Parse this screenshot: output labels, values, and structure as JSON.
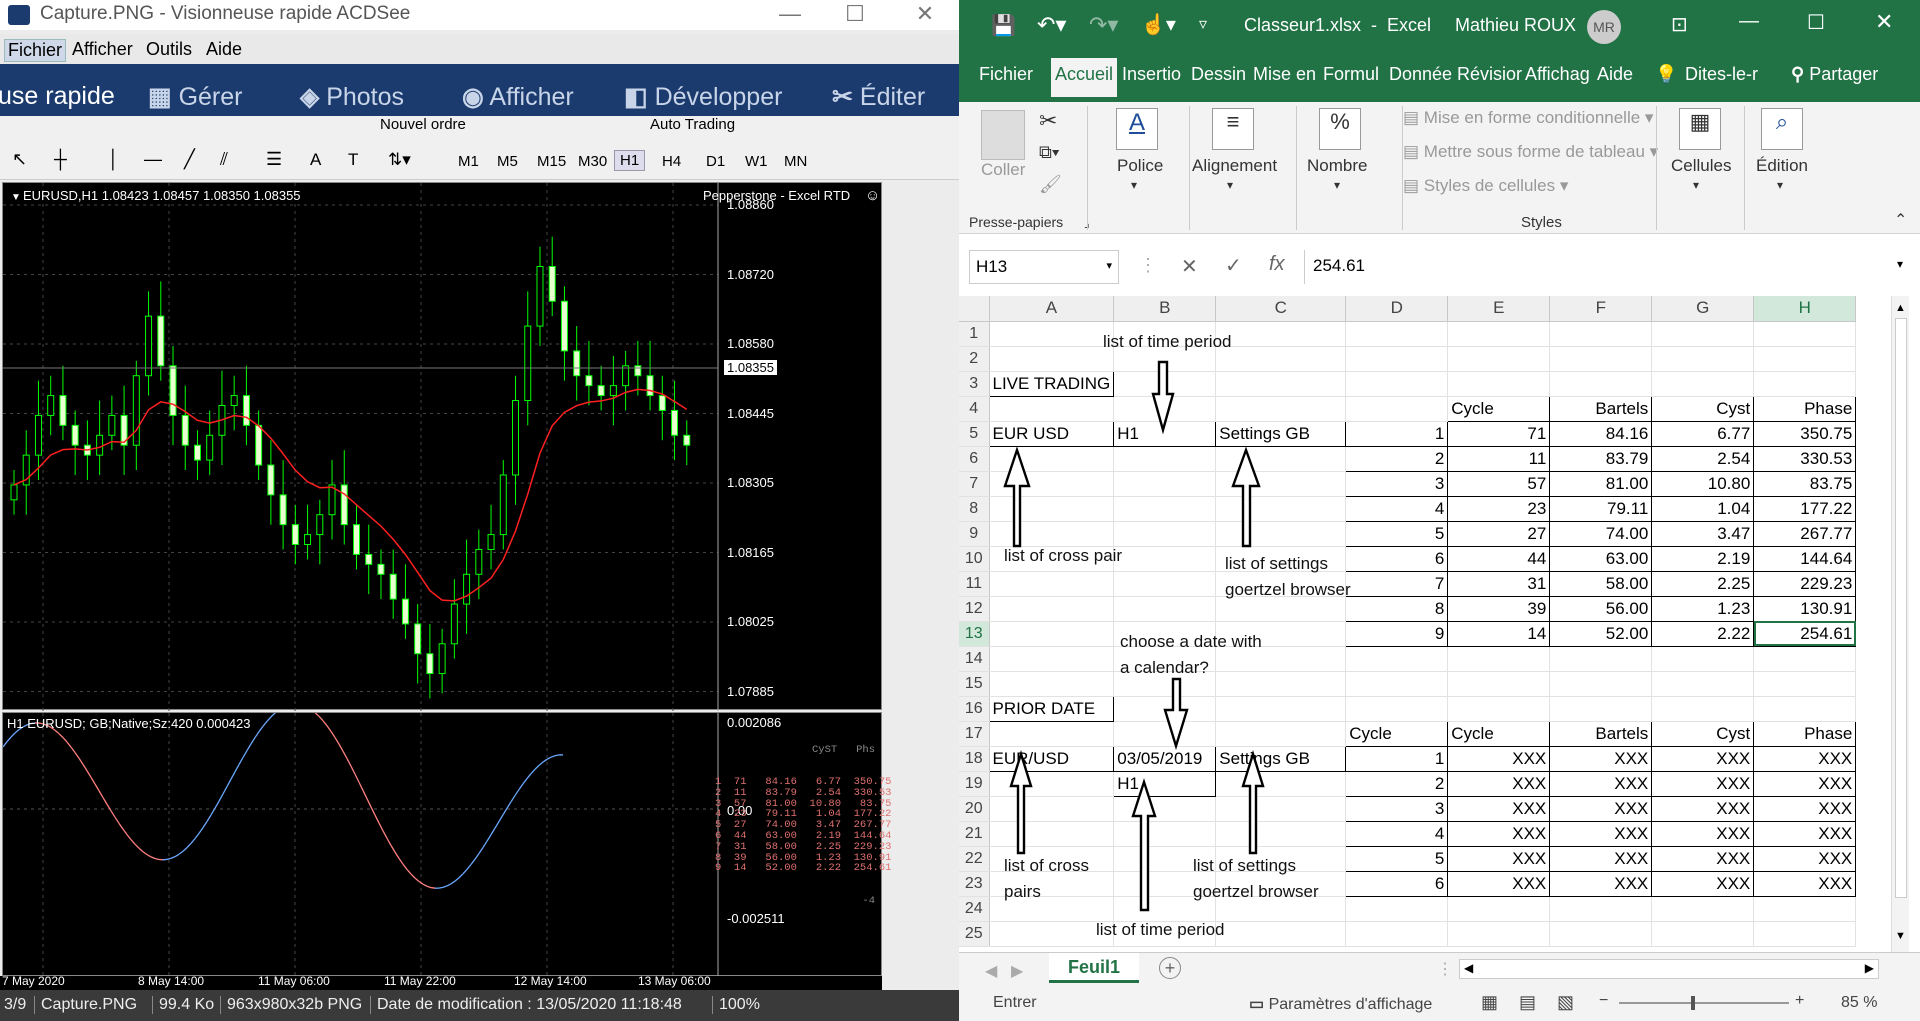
{
  "viewer": {
    "title": "Capture.PNG - Visionneuse rapide ACDSee",
    "menu": [
      "Fichier",
      "Afficher",
      "Outils",
      "Aide"
    ],
    "modes": [
      "use rapide",
      "Gérer",
      "Photos",
      "Afficher",
      "Développer",
      "Éditer"
    ],
    "toolbar_partial": [
      "Nouvel ordre",
      "Auto Trading"
    ],
    "timeframes": [
      "M1",
      "M5",
      "M15",
      "M30",
      "H1",
      "H4",
      "D1",
      "W1",
      "MN"
    ],
    "active_timeframe": "H1",
    "status": {
      "index": "3/9",
      "file": "Capture.PNG",
      "size": "99.4 Ko",
      "dims": "963x980x32b PNG",
      "modified": "Date de modification : 13/05/2020 11:18:48",
      "zoom": "100%"
    }
  },
  "chart": {
    "header": "EURUSD,H1  1.08423 1.08457 1.08350 1.08355",
    "provider": "Pepperstone - Excel RTD",
    "price_ticks": [
      "1.08860",
      "1.08720",
      "1.08580",
      "1.08445",
      "1.08305",
      "1.08165",
      "1.08025",
      "1.07885"
    ],
    "current_price": "1.08355",
    "indicator_header": "H1 EURUSD; GB;Native;Sz:420 0.000423",
    "indicator_ticks": [
      "0.002086",
      "0.00",
      "-0.002511"
    ],
    "indicator_table_header": [
      "CyST",
      "Phs"
    ],
    "indicator_table_rows": [
      "1  71   84.16   6.77  350.75",
      "2  11   83.79   2.54  330.53",
      "3  57   81.00  10.80   83.75",
      "4  23   79.11   1.04  177.22",
      "5  27   74.00   3.47  267.77",
      "6  44   63.00   2.19  144.64",
      "7  31   58.00   2.25  229.23",
      "8  39   56.00   1.23  130.91",
      "9  14   52.00   2.22  254.61"
    ],
    "indicator_marker": "-4",
    "time_ticks": [
      "7 May 2020",
      "8 May 14:00",
      "11 May 06:00",
      "11 May 22:00",
      "12 May 14:00",
      "13 May 06:00"
    ],
    "colors": {
      "bull": "#00ff00",
      "ma": "#ff2020",
      "osc_up": "#6aa8ff",
      "osc_down": "#ff8080"
    }
  },
  "excel": {
    "title": "Classeur1.xlsx  -  Excel",
    "user": "Mathieu ROUX",
    "user_initials": "MR",
    "tabs": [
      "Fichier",
      "Accueil",
      "Insertio",
      "Dessin",
      "Mise en",
      "Formul",
      "Donnée",
      "Révisior",
      "Affichag",
      "Aide"
    ],
    "active_tab": "Accueil",
    "tell_me": "Dites-le-r",
    "share": "Partager",
    "ribbon": {
      "paste": "Coller",
      "clipboard_group": "Presse-papiers",
      "font": "Police",
      "alignment": "Alignement",
      "number": "Nombre",
      "cond_format": "Mise en forme conditionnelle",
      "table_format": "Mettre sous forme de tableau",
      "cell_styles": "Styles de cellules",
      "styles_group": "Styles",
      "cells": "Cellules",
      "editing": "Édition"
    },
    "name_box": "H13",
    "formula": "254.61",
    "col_headers": [
      "A",
      "B",
      "C",
      "D",
      "E",
      "F",
      "G",
      "H"
    ],
    "rows": [
      [
        "",
        "",
        "",
        "",
        "",
        "",
        "",
        ""
      ],
      [
        "",
        "",
        "",
        "",
        "",
        "",
        "",
        ""
      ],
      [
        "LIVE TRADING",
        "",
        "",
        "",
        "",
        "",
        "",
        ""
      ],
      [
        "",
        "",
        "",
        "",
        "Cycle",
        "Bartels",
        "Cyst",
        "Phase"
      ],
      [
        "EUR USD",
        "H1",
        "Settings GB",
        "1",
        "71",
        "84.16",
        "6.77",
        "350.75"
      ],
      [
        "",
        "",
        "",
        "2",
        "11",
        "83.79",
        "2.54",
        "330.53"
      ],
      [
        "",
        "",
        "",
        "3",
        "57",
        "81.00",
        "10.80",
        "83.75"
      ],
      [
        "",
        "",
        "",
        "4",
        "23",
        "79.11",
        "1.04",
        "177.22"
      ],
      [
        "",
        "",
        "",
        "5",
        "27",
        "74.00",
        "3.47",
        "267.77"
      ],
      [
        "",
        "",
        "",
        "6",
        "44",
        "63.00",
        "2.19",
        "144.64"
      ],
      [
        "",
        "",
        "",
        "7",
        "31",
        "58.00",
        "2.25",
        "229.23"
      ],
      [
        "",
        "",
        "",
        "8",
        "39",
        "56.00",
        "1.23",
        "130.91"
      ],
      [
        "",
        "",
        "",
        "9",
        "14",
        "52.00",
        "2.22",
        "254.61"
      ],
      [
        "",
        "",
        "",
        "",
        "",
        "",
        "",
        ""
      ],
      [
        "",
        "",
        "",
        "",
        "",
        "",
        "",
        ""
      ],
      [
        "PRIOR DATE",
        "",
        "",
        "",
        "",
        "",
        "",
        ""
      ],
      [
        "",
        "",
        "",
        "Cycle",
        "Cycle",
        "Bartels",
        "Cyst",
        "Phase"
      ],
      [
        "EUR/USD",
        "03/05/2019",
        "Settings GB",
        "1",
        "XXX",
        "XXX",
        "XXX",
        "XXX"
      ],
      [
        "",
        "H1",
        "",
        "2",
        "XXX",
        "XXX",
        "XXX",
        "XXX"
      ],
      [
        "",
        "",
        "",
        "3",
        "XXX",
        "XXX",
        "XXX",
        "XXX"
      ],
      [
        "",
        "",
        "",
        "4",
        "XXX",
        "XXX",
        "XXX",
        "XXX"
      ],
      [
        "",
        "",
        "",
        "5",
        "XXX",
        "XXX",
        "XXX",
        "XXX"
      ],
      [
        "",
        "",
        "",
        "6",
        "XXX",
        "XXX",
        "XXX",
        "XXX"
      ],
      [
        "",
        "",
        "",
        "",
        "",
        "",
        "",
        ""
      ],
      [
        "",
        "",
        "",
        "",
        "",
        "",
        "",
        ""
      ]
    ],
    "annotations": {
      "time_period_top": "list of time period",
      "cross_pair": "list of cross pair",
      "settings_1": "list of settings",
      "settings_1b": "goertzel browser",
      "calendar_1": "choose a date with",
      "calendar_2": "a calendar?",
      "cross_pairs_1": "list of cross",
      "cross_pairs_2": "pairs",
      "settings_2": "list of settings",
      "settings_2b": "goertzel browser",
      "time_period_bottom": "list of time period"
    },
    "sheet_tab": "Feuil1",
    "status_left": "Entrer",
    "display_settings": "Paramètres d'affichage",
    "zoom": "85 %"
  }
}
